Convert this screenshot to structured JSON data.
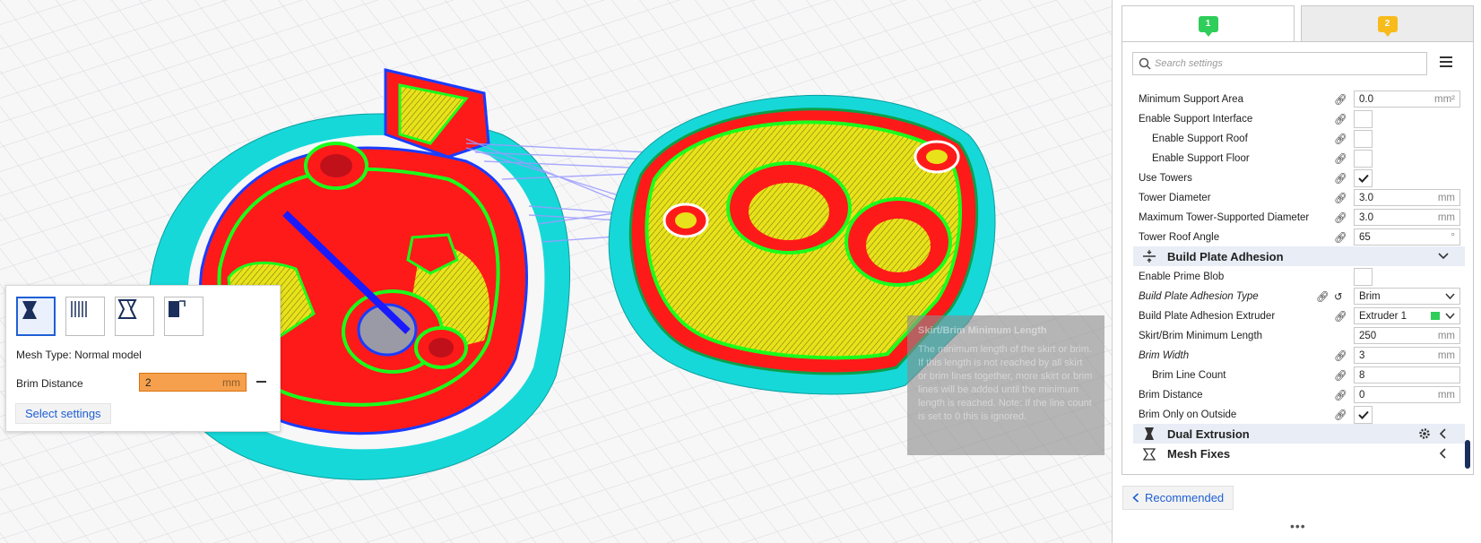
{
  "popup": {
    "mesh_types": [
      {
        "name": "normal-model-icon"
      },
      {
        "name": "support-mesh-icon"
      },
      {
        "name": "overlap-mesh-icon"
      },
      {
        "name": "anti-overhang-mesh-icon"
      }
    ],
    "mesh_type_label": "Mesh Type: Normal model",
    "brim_distance_label": "Brim Distance",
    "brim_distance_value": "2",
    "brim_distance_unit": "mm",
    "select_settings_label": "Select settings"
  },
  "tooltip": {
    "title": "Skirt/Brim Minimum Length",
    "body": "The minimum length of the skirt or brim. If this length is not reached by all skirt or brim lines together, more skirt or brim lines will be added until the minimum length is reached. Note: If the line count is set to 0 this is ignored."
  },
  "panel": {
    "tabs": [
      {
        "label": "1",
        "color": "#2fcd5a"
      },
      {
        "label": "2",
        "color": "#f7bb1b"
      }
    ],
    "search_placeholder": "Search settings",
    "rows": {
      "min_support_area": {
        "label": "Minimum Support Area",
        "value": "0.0",
        "unit": "mm²"
      },
      "enable_support_interface": {
        "label": "Enable Support Interface",
        "checked": false
      },
      "enable_support_roof": {
        "label": "Enable Support Roof",
        "checked": false
      },
      "enable_support_floor": {
        "label": "Enable Support Floor",
        "checked": false
      },
      "use_towers": {
        "label": "Use Towers",
        "checked": true
      },
      "tower_diameter": {
        "label": "Tower Diameter",
        "value": "3.0",
        "unit": "mm"
      },
      "max_tower_diameter": {
        "label": "Maximum Tower-Supported Diameter",
        "value": "3.0",
        "unit": "mm"
      },
      "tower_roof_angle": {
        "label": "Tower Roof Angle",
        "value": "65",
        "unit": "°"
      },
      "enable_prime_blob": {
        "label": "Enable Prime Blob",
        "checked": false
      },
      "adhesion_type": {
        "label": "Build Plate Adhesion Type",
        "value": "Brim"
      },
      "adhesion_extruder": {
        "label": "Build Plate Adhesion Extruder",
        "value": "Extruder 1"
      },
      "skirt_brim_min_length": {
        "label": "Skirt/Brim Minimum Length",
        "value": "250",
        "unit": "mm"
      },
      "brim_width": {
        "label": "Brim Width",
        "value": "3",
        "unit": "mm"
      },
      "brim_line_count": {
        "label": "Brim Line Count",
        "value": "8"
      },
      "brim_distance": {
        "label": "Brim Distance",
        "value": "0",
        "unit": "mm"
      },
      "brim_only_outside": {
        "label": "Brim Only on Outside",
        "checked": true
      }
    },
    "categories": {
      "adhesion": "Build Plate Adhesion",
      "dual": "Dual Extrusion",
      "mesh_fixes": "Mesh Fixes"
    },
    "recommended_label": "Recommended",
    "dots": "•••"
  },
  "colors": {
    "accent": "#1e5fd6",
    "extruder1": "#2fcd5a",
    "extruder2": "#f7bb1b",
    "model_wall": "#ff1a1a",
    "model_infill": "#e8e21a",
    "model_skin": "#1aff1a",
    "brim": "#1ae0e0",
    "travel": "#9b9bff"
  }
}
